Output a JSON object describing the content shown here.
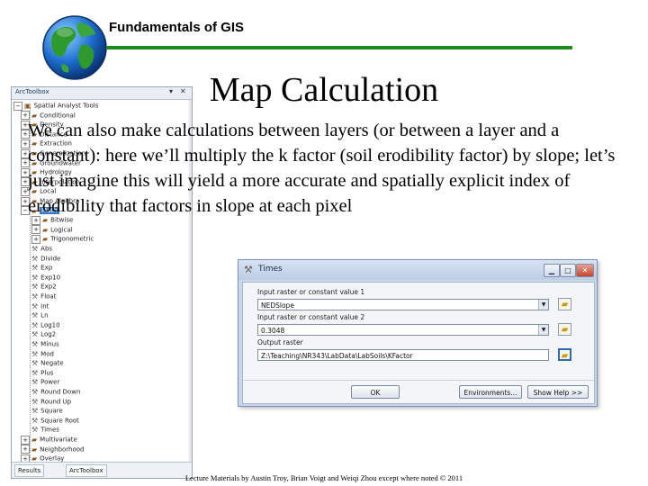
{
  "header": {
    "title": "Fundamentals of GIS"
  },
  "toolbox": {
    "title": "ArcToolbox",
    "root_label": "Spatial Analyst Tools",
    "items": [
      {
        "label": "Conditional",
        "kind": "toolset"
      },
      {
        "label": "Density",
        "kind": "toolset"
      },
      {
        "label": "Distance",
        "kind": "toolset"
      },
      {
        "label": "Extraction",
        "kind": "toolset"
      },
      {
        "label": "Generalization",
        "kind": "toolset"
      },
      {
        "label": "Groundwater",
        "kind": "toolset"
      },
      {
        "label": "Hydrology",
        "kind": "toolset"
      },
      {
        "label": "Interpolation",
        "kind": "toolset"
      },
      {
        "label": "Local",
        "kind": "toolset"
      },
      {
        "label": "Map Algebra",
        "kind": "toolset"
      },
      {
        "label": "Math",
        "kind": "toolset",
        "selected": true
      },
      {
        "label": "Bitwise",
        "kind": "toolset"
      },
      {
        "label": "Logical",
        "kind": "toolset"
      },
      {
        "label": "Trigonometric",
        "kind": "toolset"
      },
      {
        "label": "Abs",
        "kind": "tool"
      },
      {
        "label": "Divide",
        "kind": "tool"
      },
      {
        "label": "Exp",
        "kind": "tool"
      },
      {
        "label": "Exp10",
        "kind": "tool"
      },
      {
        "label": "Exp2",
        "kind": "tool"
      },
      {
        "label": "Float",
        "kind": "tool"
      },
      {
        "label": "Int",
        "kind": "tool"
      },
      {
        "label": "Ln",
        "kind": "tool"
      },
      {
        "label": "Log10",
        "kind": "tool"
      },
      {
        "label": "Log2",
        "kind": "tool"
      },
      {
        "label": "Minus",
        "kind": "tool"
      },
      {
        "label": "Mod",
        "kind": "tool"
      },
      {
        "label": "Negate",
        "kind": "tool"
      },
      {
        "label": "Plus",
        "kind": "tool"
      },
      {
        "label": "Power",
        "kind": "tool"
      },
      {
        "label": "Round Down",
        "kind": "tool"
      },
      {
        "label": "Round Up",
        "kind": "tool"
      },
      {
        "label": "Square",
        "kind": "tool"
      },
      {
        "label": "Square Root",
        "kind": "tool"
      },
      {
        "label": "Times",
        "kind": "tool"
      },
      {
        "label": "Multivariate",
        "kind": "toolset"
      },
      {
        "label": "Neighborhood",
        "kind": "toolset"
      },
      {
        "label": "Overlay",
        "kind": "toolset"
      }
    ],
    "tabs": [
      "Results",
      "ArcToolbox"
    ]
  },
  "slide": {
    "title": "Map Calculation",
    "body": "We can also make calculations between layers (or between a layer and a constant): here we’ll multiply the k factor (soil erodibility factor) by slope; let’s just imagine this will yield a more accurate and spatially explicit index of erodibility that factors in slope at each pixel"
  },
  "dialog": {
    "title": "Times",
    "input1_label": "Input raster or constant value 1",
    "input1_value": "NEDSlope",
    "input2_label": "Input raster or constant value 2",
    "input2_value": "0.3048",
    "output_label": "Output raster",
    "output_value": "Z:\\Teaching\\NR343\\LabData\\LabSoils\\KFactor",
    "ok_label": "OK",
    "env_label": "Environments...",
    "help_label": "Show Help >>",
    "min_glyph": "▁",
    "max_glyph": "□",
    "close_glyph": "✕"
  },
  "footer": {
    "text": "Lecture Materials by Austin Troy, Brian Voigt and Weiqi Zhou except where noted © 2011"
  },
  "colors": {
    "header_rule": "#1f8a1f",
    "selection": "#3b78c2",
    "dialog_frame": "#c9d7ea"
  }
}
